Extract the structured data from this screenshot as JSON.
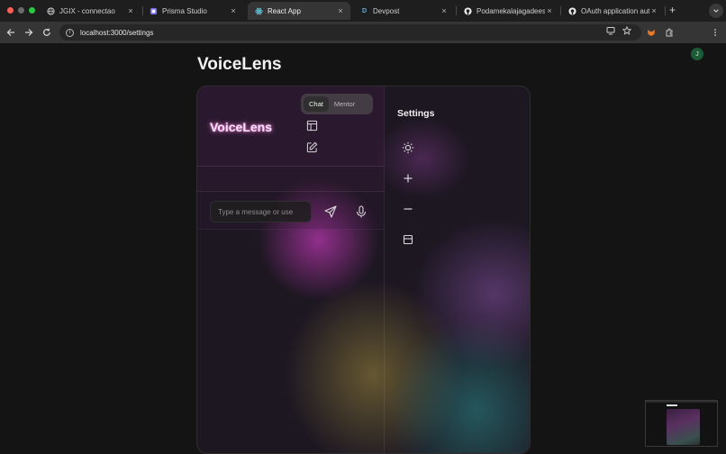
{
  "browser": {
    "tabs": [
      {
        "title": "JGIX - connectao",
        "icon": "globe-icon"
      },
      {
        "title": "Prisma Studio",
        "icon": "prisma-icon"
      },
      {
        "title": "React App",
        "icon": "react-icon"
      },
      {
        "title": "Devpost",
        "icon": "devpost-icon"
      },
      {
        "title": "Podamekalajagadeesh/",
        "icon": "github-icon"
      },
      {
        "title": "OAuth application auth",
        "icon": "github-icon"
      }
    ],
    "active_tab": 2,
    "close_glyph": "×",
    "new_tab_glyph": "+",
    "url": "localhost:3000/settings",
    "profile_initial": "J"
  },
  "page": {
    "title": "VoiceLens"
  },
  "chat_panel": {
    "brand": "VoiceLens",
    "modes": [
      "Chat",
      "Mentor"
    ],
    "active_mode": "Chat",
    "input_placeholder": "Type a message or use"
  },
  "settings_panel": {
    "title": "Settings",
    "icons": [
      "sun-icon",
      "plus-icon",
      "minus-icon",
      "layout-icon"
    ]
  },
  "colors": {
    "accent_pink": "#f6e2f6",
    "background": "#141414"
  }
}
